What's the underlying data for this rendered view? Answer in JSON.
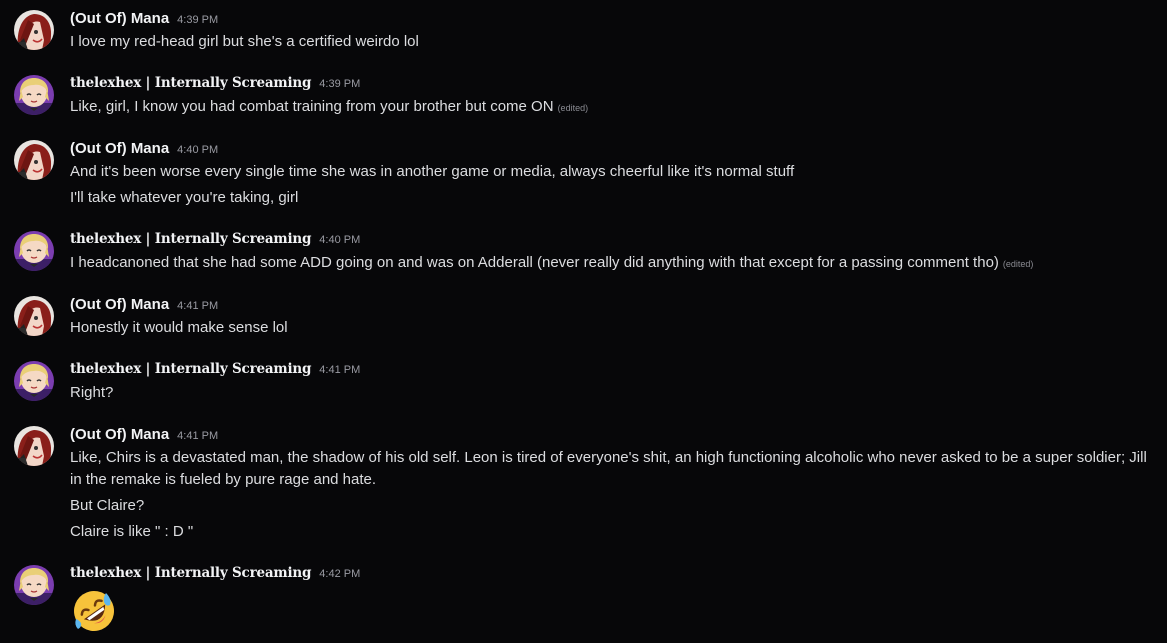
{
  "messages": [
    {
      "author": "(Out Of) Mana",
      "timestamp": "4:39 PM",
      "lines": [
        "I love my red-head girl but she's a certified weirdo lol"
      ]
    },
    {
      "author": "thelexhex | Internally Screaming",
      "timestamp": "4:39 PM",
      "lines": [
        "Like, girl, I know you had combat training from your brother but come ON"
      ],
      "edited": "(edited)"
    },
    {
      "author": "(Out Of) Mana",
      "timestamp": "4:40 PM",
      "lines": [
        "And it's been worse every single time she was in another game or media, always cheerful like it's normal stuff",
        "I'll take whatever you're taking, girl"
      ]
    },
    {
      "author": "thelexhex | Internally Screaming",
      "timestamp": "4:40 PM",
      "lines": [
        "I headcanoned that she had some ADD going on and was on Adderall (never really did anything with that except for a passing comment tho)"
      ],
      "edited": "(edited)"
    },
    {
      "author": "(Out Of) Mana",
      "timestamp": "4:41 PM",
      "lines": [
        "Honestly it would make sense lol"
      ]
    },
    {
      "author": "thelexhex | Internally Screaming",
      "timestamp": "4:41 PM",
      "lines": [
        "Right?"
      ]
    },
    {
      "author": "(Out Of) Mana",
      "timestamp": "4:41 PM",
      "lines": [
        "Like, Chirs is a devastated man, the shadow of his old self. Leon is tired of everyone's shit, an high functioning alcoholic who never asked to be a super soldier; Jill in the remake is fueled by pure rage and hate.",
        "But Claire?",
        "Claire is like \" : D \""
      ]
    },
    {
      "author": "thelexhex | Internally Screaming",
      "timestamp": "4:42 PM",
      "emoji": "rolling-on-floor-laughing-emoji"
    }
  ],
  "colors": {
    "background": "#070709",
    "text": "#dcdde0",
    "username": "#f2f3f5",
    "timestamp": "#9a9ba3"
  }
}
